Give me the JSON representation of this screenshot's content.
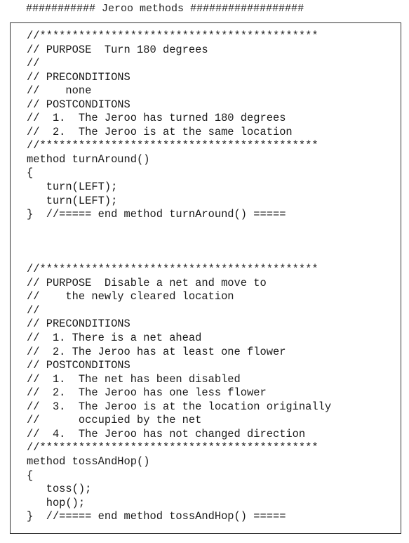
{
  "heading": "########### Jeroo methods ##################",
  "code_lines": [
    "//*******************************************",
    "// PURPOSE  Turn 180 degrees",
    "//",
    "// PRECONDITIONS",
    "//    none",
    "// POSTCONDITONS",
    "//  1.  The Jeroo has turned 180 degrees",
    "//  2.  The Jeroo is at the same location",
    "//*******************************************",
    "method turnAround()",
    "{",
    "   turn(LEFT);",
    "   turn(LEFT);",
    "}  //===== end method turnAround() =====",
    "",
    "",
    "",
    "//*******************************************",
    "// PURPOSE  Disable a net and move to",
    "//    the newly cleared location",
    "//",
    "// PRECONDITIONS",
    "//  1. There is a net ahead",
    "//  2. The Jeroo has at least one flower",
    "// POSTCONDITONS",
    "//  1.  The net has been disabled",
    "//  2.  The Jeroo has one less flower",
    "//  3.  The Jeroo is at the location originally",
    "//      occupied by the net",
    "//  4.  The Jeroo has not changed direction",
    "//*******************************************",
    "method tossAndHop()",
    "{",
    "   toss();",
    "   hop();",
    "}  //===== end method tossAndHop() ====="
  ]
}
